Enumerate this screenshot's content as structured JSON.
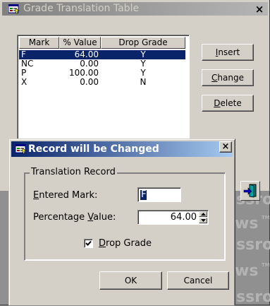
{
  "window": {
    "title": "Grade Translation Table",
    "close_glyph": "×"
  },
  "grid": {
    "columns": [
      "Mark",
      "% Value",
      "Drop Grade"
    ],
    "rows": [
      {
        "mark": "F",
        "value": "64.00",
        "drop": "Y",
        "selected": true
      },
      {
        "mark": "NC",
        "value": "0.00",
        "drop": "Y",
        "selected": false
      },
      {
        "mark": "P",
        "value": "100.00",
        "drop": "Y",
        "selected": false
      },
      {
        "mark": "X",
        "value": "0.00",
        "drop": "N",
        "selected": false
      }
    ]
  },
  "buttons": {
    "insert": {
      "mnemonic": "I",
      "rest": "nsert"
    },
    "change": {
      "mnemonic": "C",
      "rest": "hange"
    },
    "delete": {
      "mnemonic": "D",
      "rest": "elete"
    }
  },
  "dialog": {
    "title": "Record will be Changed",
    "close_glyph": "×",
    "group_label": "Translation Record",
    "entered_mark": {
      "mnemonic": "E",
      "rest": "ntered Mark:",
      "value": "F"
    },
    "percentage": {
      "before": "Percentage ",
      "mnemonic": "V",
      "rest": "alue:",
      "value": "64.00"
    },
    "drop_grade": {
      "mnemonic": "D",
      "rest": "rop Grade",
      "checked": true
    },
    "ok_label": "OK",
    "cancel_label": "Cancel"
  },
  "watermark": {
    "word_a": "ssro",
    "word_b": "ws",
    "tm": "TM"
  },
  "icons": {
    "app": "app-window-icon",
    "exit": "exit-door-icon",
    "spin_up": "arrow-up-icon",
    "spin_down": "arrow-down-icon",
    "check": "checkmark-icon"
  },
  "colors": {
    "face": "#d4d0c8",
    "active_title": "#0a246a",
    "inactive_title": "#808080",
    "selection": "#0a246a"
  }
}
